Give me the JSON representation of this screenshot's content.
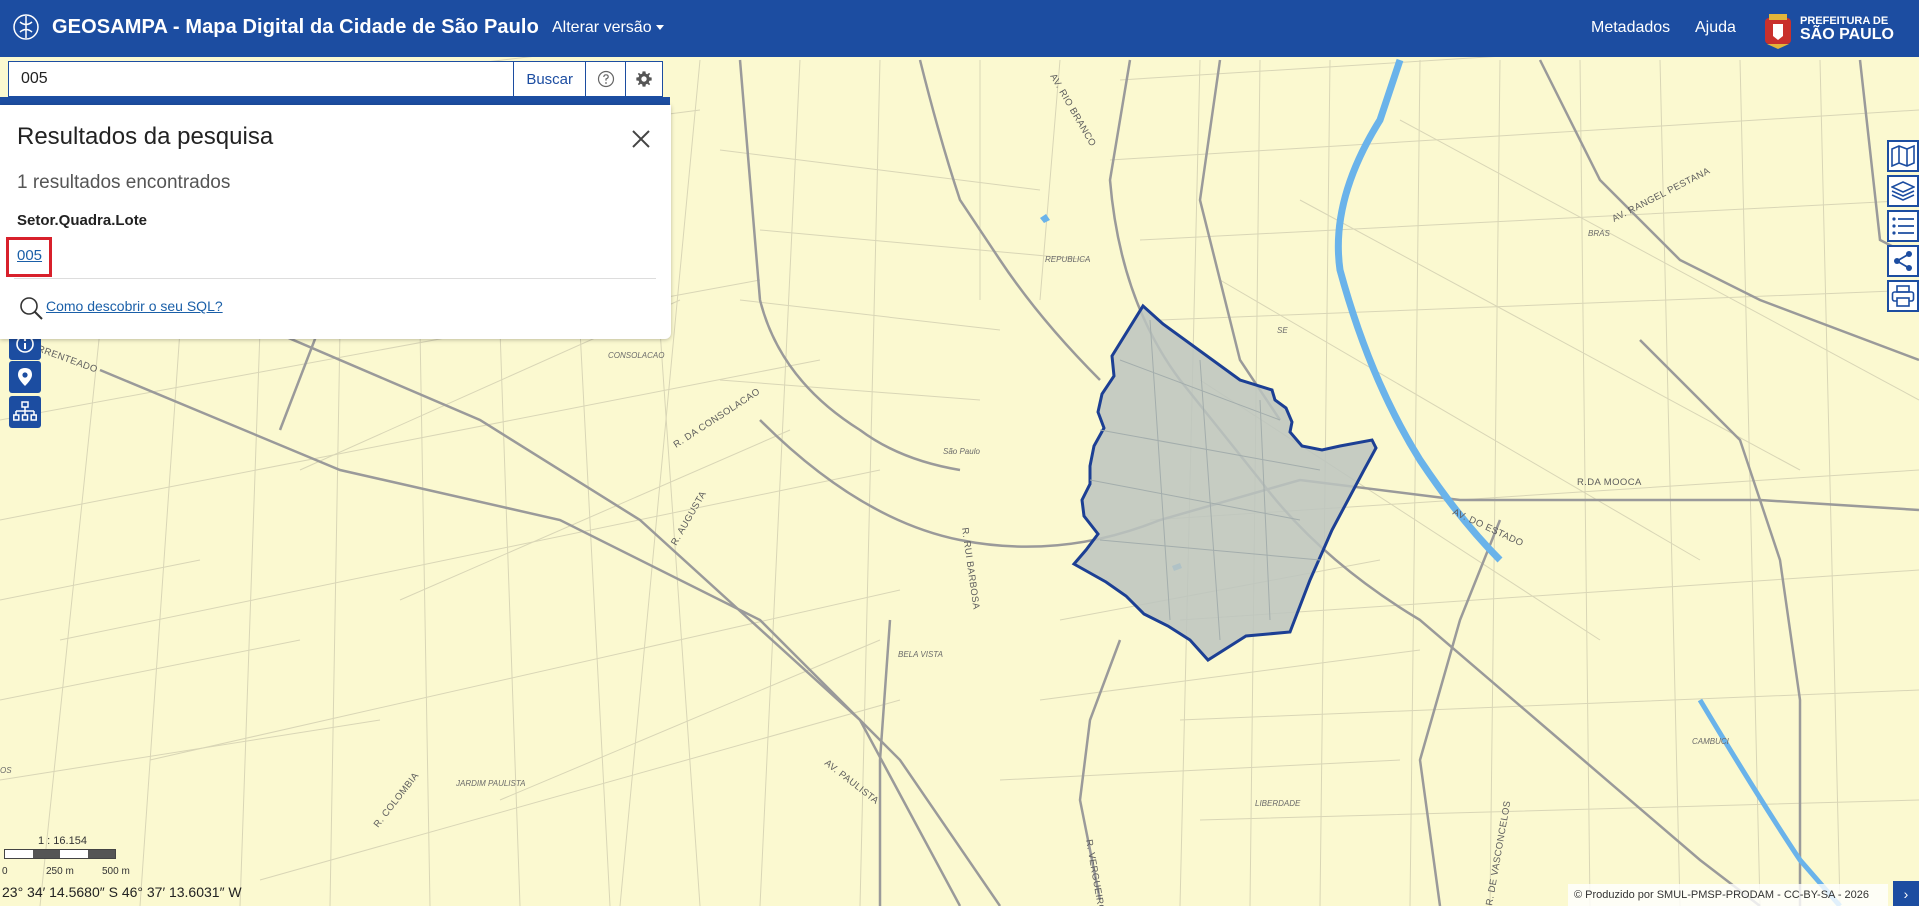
{
  "header": {
    "title": "GEOSAMPA - Mapa Digital da Cidade de São Paulo",
    "version_menu_label": "Alterar versão",
    "links": [
      "Metadados",
      "Ajuda"
    ],
    "prefeitura_line1": "PREFEITURA DE",
    "prefeitura_line2": "SÃO PAULO"
  },
  "search": {
    "value": "005",
    "button_label": "Buscar",
    "help_icon": "help-circle-icon",
    "settings_icon": "gear-icon"
  },
  "results": {
    "title": "Resultados da pesquisa",
    "count_text": "1 resultados encontrados",
    "group_label": "Setor.Quadra.Lote",
    "items": [
      "005"
    ],
    "help_link": "Como descobrir o seu SQL?"
  },
  "left_tools": [
    "info-icon",
    "pin-icon",
    "hierarchy-icon"
  ],
  "right_tools": [
    "map-icon",
    "layers-icon",
    "list-icon",
    "share-icon",
    "print-icon"
  ],
  "map": {
    "street_labels": [
      "AV. RIO BRANCO",
      "REPUBLICA",
      "SE",
      "AV. RANGEL PESTANA",
      "BRAS",
      "CONSOLACAO",
      "R. DA CONSOLACAO",
      "São Paulo",
      "R. AUGUSTA",
      "R. RUI BARBOSA",
      "R.DA MOOCA",
      "AV. DO ESTADO",
      "BELA VISTA",
      "JARDIM PAULISTA",
      "AV. PAULISTA",
      "R. COLOMBIA",
      "LIBERDADE",
      "CAMBUCI",
      "R. VERGUEIRO",
      "R. DE VASCONCELOS",
      "IRRENTEADO",
      "OS"
    ],
    "highlight_fill": "#bcc4c0",
    "highlight_stroke": "#1c3f94"
  },
  "scale": {
    "ratio": "1 : 16.154",
    "tick_labels": [
      "0",
      "250 m",
      "500 m"
    ]
  },
  "coordinates": "23° 34′ 14.5680″ S 46° 37′ 13.6031″ W",
  "credits": "© Produzido por SMUL-PMSP-PRODAM - CC-BY-SA - 2026",
  "expand_label": "›",
  "colors": {
    "header_bg": "#1c4da1",
    "map_bg": "#fbf9d0",
    "highlight_box": "#d8202b",
    "link": "#1a5fa8"
  }
}
